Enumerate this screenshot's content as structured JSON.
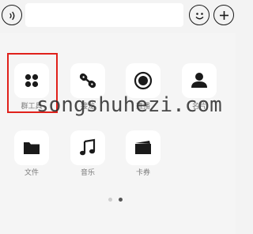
{
  "input_bar": {
    "message_value": "",
    "voice_icon": "voice-icon",
    "emoji_icon": "emoji-icon",
    "plus_icon": "plus-icon"
  },
  "panel": {
    "items": [
      {
        "label": "群工具",
        "icon": "grid-dots-icon"
      },
      {
        "label": "接龙",
        "icon": "chain-icon"
      },
      {
        "label": "直播",
        "icon": "record-icon"
      },
      {
        "label": "名片",
        "icon": "person-icon"
      },
      {
        "label": "文件",
        "icon": "folder-icon"
      },
      {
        "label": "音乐",
        "icon": "music-note-icon"
      },
      {
        "label": "卡券",
        "icon": "wallet-icon"
      }
    ],
    "page_count": 2,
    "current_page": 2
  },
  "watermark": "songshuhezi.com",
  "colors": {
    "highlight": "#e0211b",
    "background": "#f5f5f5",
    "tile": "#ffffff"
  }
}
